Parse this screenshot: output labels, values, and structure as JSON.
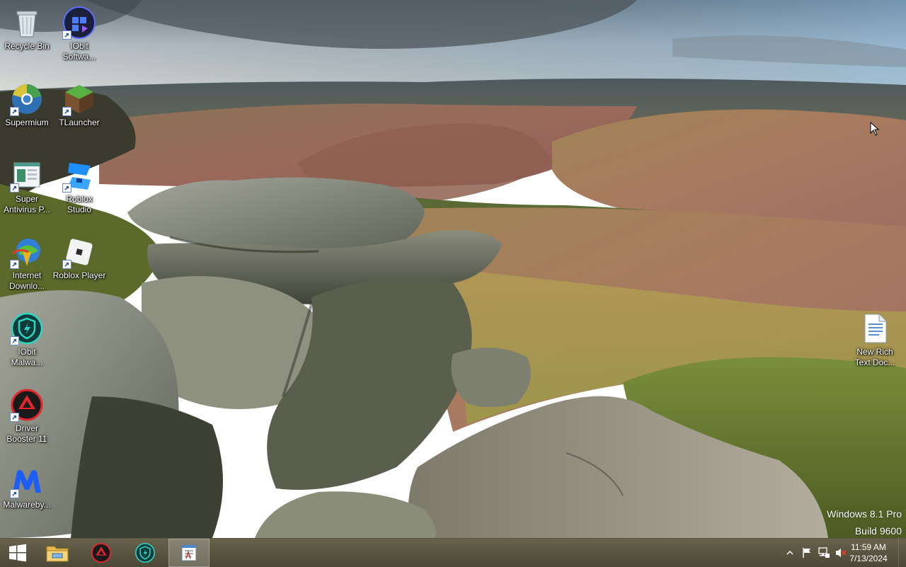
{
  "desktop": {
    "icons": [
      {
        "label": "Recycle Bin",
        "icon": "recycle-bin-icon"
      },
      {
        "label": "IObit\nSoftwa...",
        "icon": "iobit-software-updater-icon"
      },
      {
        "label": "Supermium",
        "icon": "supermium-icon"
      },
      {
        "label": "TLauncher",
        "icon": "tlauncher-icon"
      },
      {
        "label": "Super\nAntivirus P...",
        "icon": "super-antivirus-icon"
      },
      {
        "label": "Roblox\nStudio",
        "icon": "roblox-studio-icon"
      },
      {
        "label": "Internet\nDownlo...",
        "icon": "internet-download-manager-icon"
      },
      {
        "label": "Roblox Player",
        "icon": "roblox-player-icon"
      },
      {
        "label": "IObit\nMalwa...",
        "icon": "iobit-malware-fighter-icon"
      },
      {
        "label": "Driver\nBooster 11",
        "icon": "driver-booster-icon"
      },
      {
        "label": "Malwareby...",
        "icon": "malwarebytes-icon"
      },
      {
        "label": "New Rich\nText Doc...",
        "icon": "rich-text-document-icon"
      }
    ],
    "watermark": {
      "line1": "Windows 8.1 Pro",
      "line2": "Build 9600"
    }
  },
  "taskbar": {
    "items": [
      {
        "icon": "windows-start-icon"
      },
      {
        "icon": "file-explorer-icon"
      },
      {
        "icon": "driver-booster-icon"
      },
      {
        "icon": "iobit-malware-fighter-icon"
      },
      {
        "icon": "wordpad-icon",
        "active": true
      }
    ],
    "tray": {
      "icons": [
        "show-hidden-icons-chevron-icon",
        "action-center-flag-icon",
        "network-icon",
        "volume-muted-icon"
      ]
    },
    "clock": {
      "time": "11:59 AM",
      "date": "7/13/2024"
    }
  },
  "colors": {
    "taskbar": "#524c36",
    "text": "#ffffff"
  }
}
